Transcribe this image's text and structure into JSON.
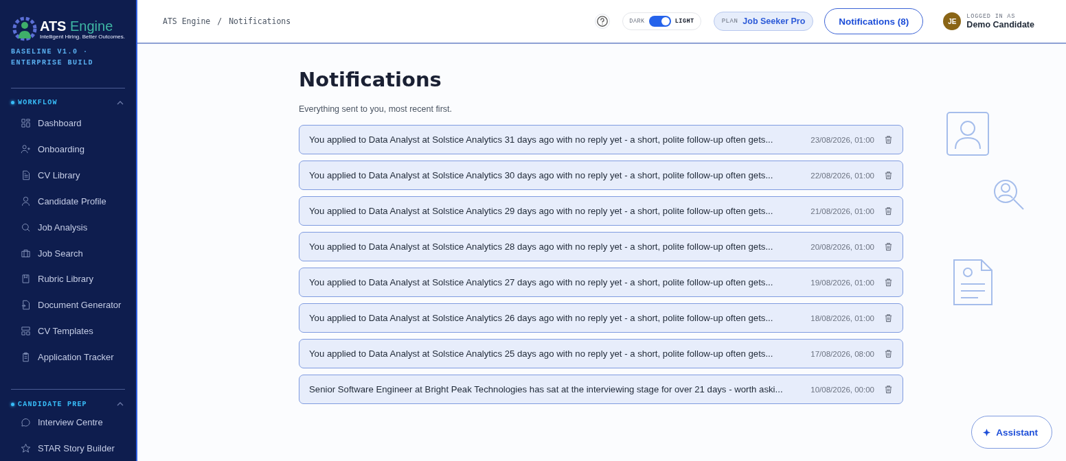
{
  "sidebar": {
    "logo": {
      "title_primary": "ATS",
      "title_accent": "Engine",
      "tagline": "Intelligent Hiring. Better Outcomes."
    },
    "build": "BASELINE V1.0 · ENTERPRISE BUILD",
    "sections": [
      {
        "title": "WORKFLOW",
        "expanded": true,
        "items": [
          {
            "label": "Dashboard",
            "selected": false
          },
          {
            "label": "Onboarding",
            "selected": false
          },
          {
            "label": "CV Library",
            "selected": false
          },
          {
            "label": "Candidate Profile",
            "selected": false
          },
          {
            "label": "Job Analysis",
            "selected": false
          },
          {
            "label": "Job Search",
            "selected": false
          },
          {
            "label": "Rubric Library",
            "selected": false
          },
          {
            "label": "Document Generator",
            "selected": false
          },
          {
            "label": "CV Templates",
            "selected": false
          },
          {
            "label": "Application Tracker",
            "selected": false
          }
        ]
      },
      {
        "title": "CANDIDATE PREP",
        "expanded": true,
        "items": [
          {
            "label": "Interview Centre",
            "selected": false
          },
          {
            "label": "STAR Story Builder",
            "selected": false
          }
        ]
      }
    ]
  },
  "header": {
    "breadcrumb": [
      "ATS Engine",
      "Notifications"
    ],
    "breadcrumb_separator": "/",
    "theme_toggle": {
      "left_label": "DARK",
      "right_label": "LIGHT",
      "on": true
    },
    "plan": {
      "label": "PLAN",
      "value": "Job Seeker Pro"
    },
    "notifications_button": "Notifications (8)",
    "user": {
      "initials": "JE",
      "caption": "LOGGED IN AS",
      "name": "Demo Candidate"
    }
  },
  "page": {
    "title": "Notifications",
    "subtitle": "Everything sent to you, most recent first.",
    "notifications": [
      {
        "text": "You applied to Data Analyst at Solstice Analytics 31 days ago with no reply yet - a short, polite follow-up often gets...",
        "time": "23/08/2026, 01:00"
      },
      {
        "text": "You applied to Data Analyst at Solstice Analytics 30 days ago with no reply yet - a short, polite follow-up often gets...",
        "time": "22/08/2026, 01:00"
      },
      {
        "text": "You applied to Data Analyst at Solstice Analytics 29 days ago with no reply yet - a short, polite follow-up often gets...",
        "time": "21/08/2026, 01:00"
      },
      {
        "text": "You applied to Data Analyst at Solstice Analytics 28 days ago with no reply yet - a short, polite follow-up often gets...",
        "time": "20/08/2026, 01:00"
      },
      {
        "text": "You applied to Data Analyst at Solstice Analytics 27 days ago with no reply yet - a short, polite follow-up often gets...",
        "time": "19/08/2026, 01:00"
      },
      {
        "text": "You applied to Data Analyst at Solstice Analytics 26 days ago with no reply yet - a short, polite follow-up often gets...",
        "time": "18/08/2026, 01:00"
      },
      {
        "text": "You applied to Data Analyst at Solstice Analytics 25 days ago with no reply yet - a short, polite follow-up often gets...",
        "time": "17/08/2026, 08:00"
      },
      {
        "text": "Senior Software Engineer at Bright Peak Technologies has sat at the interviewing stage for over 21 days - worth aski...",
        "time": "10/08/2026, 00:00"
      }
    ]
  },
  "assistant_button": "Assistant"
}
